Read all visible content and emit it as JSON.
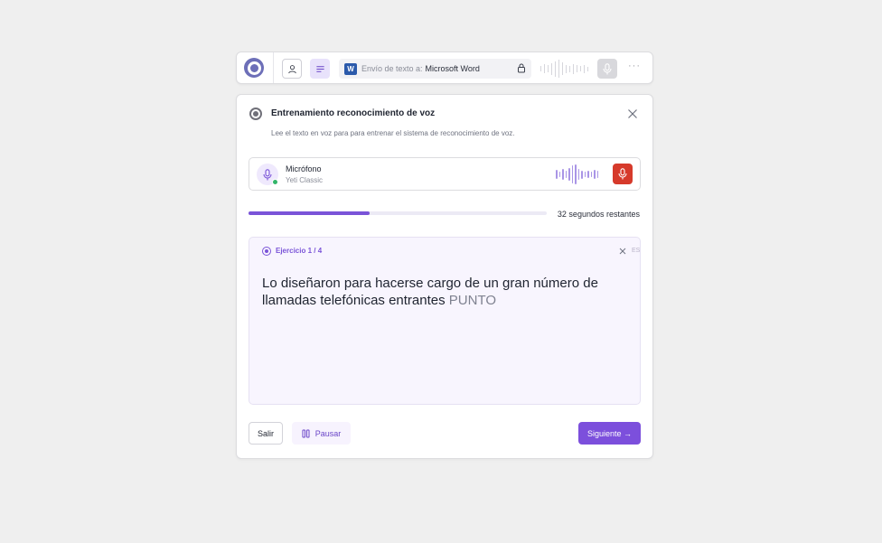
{
  "colors": {
    "accent": "#7c4fdc",
    "brand": "#6d6fb8",
    "record": "#d63a2b",
    "online": "#33b56a"
  },
  "toolbar": {
    "logo_icon": "app-logo-icon",
    "user_icon": "user-icon",
    "text_mode_icon": "text-lines-icon",
    "target_prefix": "Envío de texto a:",
    "target_app": "Microsoft Word",
    "word_glyph": "W",
    "lock_icon": "lock-icon",
    "mic_icon": "microphone-icon",
    "more_label": "···"
  },
  "dialog": {
    "title": "Entrenamiento reconocimiento de voz",
    "description": "Lee el texto en voz para para entrenar el sistema de reconocimiento de voz.",
    "close_icon": "close-icon",
    "microphone": {
      "label": "Micrófono",
      "device": "Yeti Classic",
      "status": "online"
    },
    "progress": {
      "fraction": 0.406,
      "remaining_text": "32 segundos restantes"
    },
    "exercise": {
      "label": "Ejercicio 1 / 4",
      "language": "ES",
      "text": "Lo diseñaron para hacerse cargo de un gran número de llamadas telefónicas entrantes",
      "command": "PUNTO"
    },
    "footer": {
      "exit_label": "Salir",
      "pause_label": "Pausar",
      "next_label": "Siguiente →"
    }
  }
}
